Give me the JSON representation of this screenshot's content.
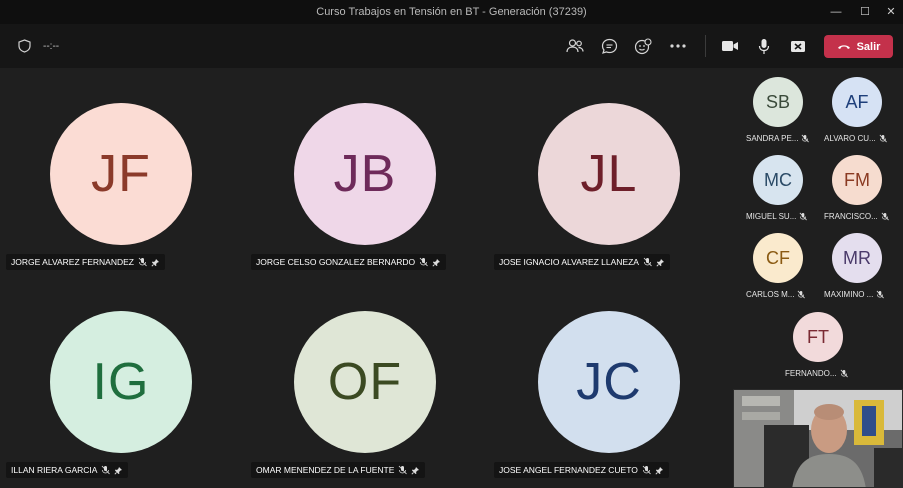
{
  "window": {
    "title": "Curso Trabajos en Tensión en BT - Generación (37239)",
    "minimize": "—",
    "maximize": "☐",
    "close": "✕"
  },
  "toolbar": {
    "timer": "--:--",
    "leave_label": "Salir",
    "leave_color": "#c4314b"
  },
  "participants_main": [
    {
      "initials": "JF",
      "name": "JORGE ALVAREZ FERNANDEZ",
      "bg": "#fbdcd4",
      "fg": "#8b3a2a"
    },
    {
      "initials": "JB",
      "name": "JORGE CELSO GONZALEZ BERNARDO",
      "bg": "#efd7e8",
      "fg": "#6e2a5a"
    },
    {
      "initials": "JL",
      "name": "JOSE IGNACIO ALVAREZ LLANEZA",
      "bg": "#ecd7d9",
      "fg": "#6e1f2a"
    },
    {
      "initials": "IG",
      "name": "ILLAN RIERA GARCIA",
      "bg": "#d5eee0",
      "fg": "#1f6e3e"
    },
    {
      "initials": "OF",
      "name": "OMAR MENENDEZ DE LA FUENTE",
      "bg": "#dfe6d6",
      "fg": "#3b4a22"
    },
    {
      "initials": "JC",
      "name": "JOSE ANGEL FERNANDEZ CUETO",
      "bg": "#d2dfee",
      "fg": "#1e3a6e"
    }
  ],
  "participants_side": [
    {
      "initials": "SB",
      "name": "SANDRA PE...",
      "bg": "#dce6dc",
      "fg": "#3a4a3a"
    },
    {
      "initials": "AF",
      "name": "ALVARO CU...",
      "bg": "#d6e2f4",
      "fg": "#1e3f7a"
    },
    {
      "initials": "MC",
      "name": "MIGUEL SU...",
      "bg": "#d7e4ef",
      "fg": "#2a4a66"
    },
    {
      "initials": "FM",
      "name": "FRANCISCO...",
      "bg": "#f6dccf",
      "fg": "#8a3a22"
    },
    {
      "initials": "CF",
      "name": "CARLOS M...",
      "bg": "#faeacd",
      "fg": "#8a5a12"
    },
    {
      "initials": "MR",
      "name": "MAXIMINO ...",
      "bg": "#e4deee",
      "fg": "#4a3a6a"
    },
    {
      "initials": "FT",
      "name": "FERNANDO...",
      "bg": "#f2dadb",
      "fg": "#7a2a33"
    }
  ]
}
